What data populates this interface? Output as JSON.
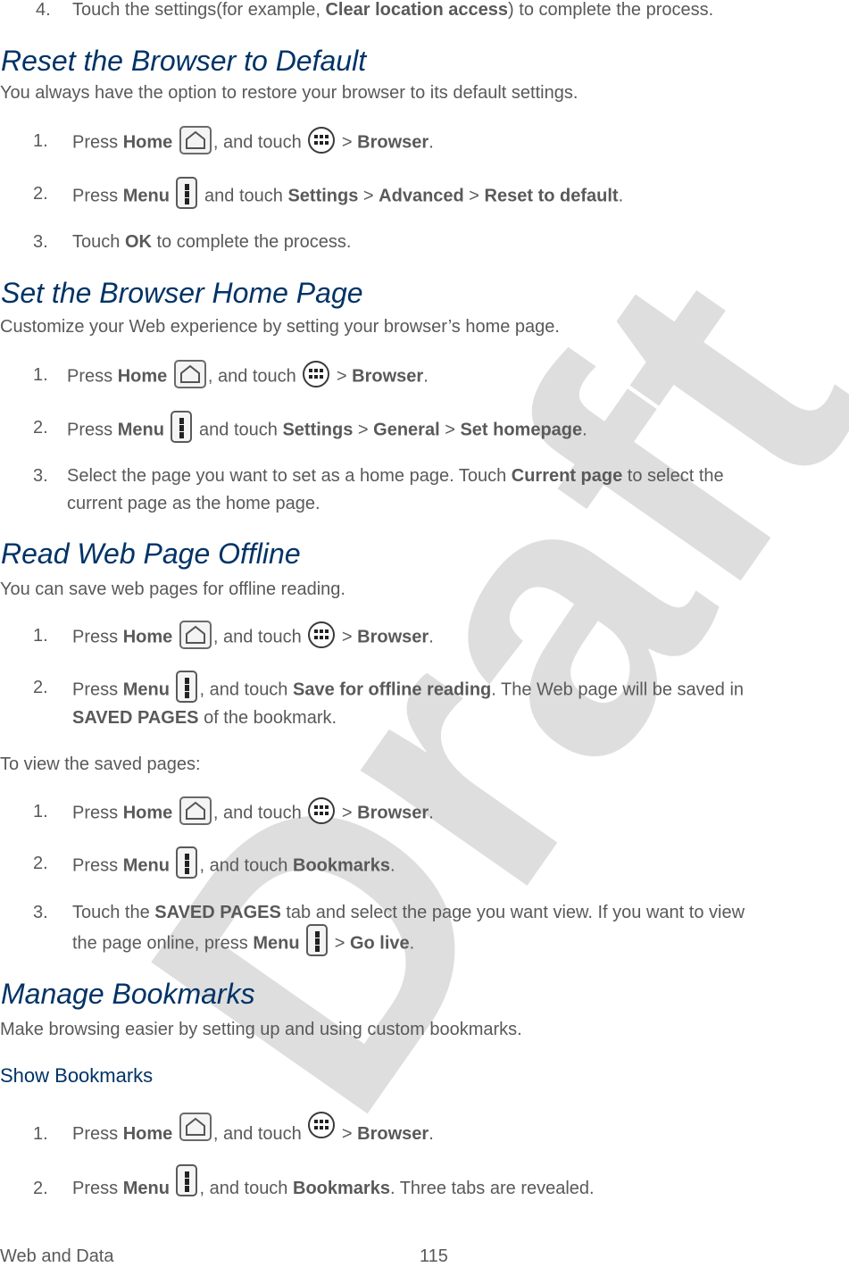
{
  "watermark": "Draft",
  "colors": {
    "heading": "#003366",
    "body": "#595959",
    "watermark": "#dedede"
  },
  "top_step": {
    "num": "4.",
    "pre": "Touch the settings(for example, ",
    "bold": "Clear location access",
    "post": ") to complete the process."
  },
  "sections": {
    "reset": {
      "title": "Reset the Browser to Default",
      "intro": "You always have the option to restore your browser to its default settings.",
      "steps": [
        {
          "num": "1.",
          "t1": "Press ",
          "b1": "Home",
          "t2": ", and touch ",
          "t3": " > ",
          "b2": "Browser",
          "t4": "."
        },
        {
          "num": "2.",
          "t1": "Press ",
          "b1": "Menu",
          "t2": " and touch ",
          "b2": "Settings",
          "t3": " > ",
          "b3": "Advanced",
          "t4": " > ",
          "b4": "Reset to default",
          "t5": "."
        },
        {
          "num": "3.",
          "t1": "Touch ",
          "b1": "OK",
          "t2": " to complete the process."
        }
      ]
    },
    "homepage": {
      "title": "Set the Browser Home Page",
      "intro": "Customize your Web experience by setting your browser’s home page.",
      "steps": [
        {
          "num": "1.",
          "t1": "Press ",
          "b1": "Home",
          "t2": ", and touch ",
          "t3": " > ",
          "b2": "Browser",
          "t4": "."
        },
        {
          "num": "2.",
          "t1": "Press ",
          "b1": "Menu",
          "t2": " and touch ",
          "b2": "Settings",
          "t3": " > ",
          "b3": "General",
          "t4": " > ",
          "b4": "Set homepage",
          "t5": "."
        },
        {
          "num": "3.",
          "t1": "Select the page you want to set as a home page. Touch ",
          "b1": "Current page",
          "t2": " to select the",
          "line2": "current page as the home page."
        }
      ]
    },
    "offline": {
      "title": "Read Web Page Offline",
      "intro": "You can save web pages for offline reading.",
      "steps": [
        {
          "num": "1.",
          "t1": "Press ",
          "b1": "Home",
          "t2": ", and touch ",
          "t3": " > ",
          "b2": "Browser",
          "t4": "."
        },
        {
          "num": "2.",
          "t1": "Press ",
          "b1": "Menu",
          "t2": ", and touch ",
          "b2": "Save for offline reading",
          "t3": ". The Web page will be saved in",
          "line2_bold": "SAVED PAGES",
          "line2_rest": " of the bookmark."
        }
      ],
      "view_intro": "To view the saved pages:",
      "view_steps": [
        {
          "num": "1.",
          "t1": "Press ",
          "b1": "Home",
          "t2": ", and touch ",
          "t3": " > ",
          "b2": "Browser",
          "t4": "."
        },
        {
          "num": "2.",
          "t1": "Press ",
          "b1": "Menu",
          "t2": ", and touch ",
          "b2": "Bookmarks",
          "t3": "."
        },
        {
          "num": "3.",
          "t1": "Touch the ",
          "b1": "SAVED PAGES",
          "t2": " tab and select the page you want view. If you want to view",
          "line2_pre": "the page online, press ",
          "line2_bold": "Menu",
          "line2_mid": " > ",
          "line2_bold2": "Go live",
          "line2_end": "."
        }
      ]
    },
    "bookmarks": {
      "title": "Manage Bookmarks",
      "intro": "Make browsing easier by setting up and using custom bookmarks.",
      "subtitle": "Show Bookmarks",
      "steps": [
        {
          "num": "1.",
          "t1": "Press ",
          "b1": "Home",
          "t2": ", and touch ",
          "t3": " > ",
          "b2": "Browser",
          "t4": "."
        },
        {
          "num": "2.",
          "t1": "Press ",
          "b1": "Menu",
          "t2": ", and touch ",
          "b2": "Bookmarks",
          "t3": ". Three tabs are revealed."
        }
      ]
    }
  },
  "footer": {
    "section": "Web and Data",
    "page": "115"
  }
}
